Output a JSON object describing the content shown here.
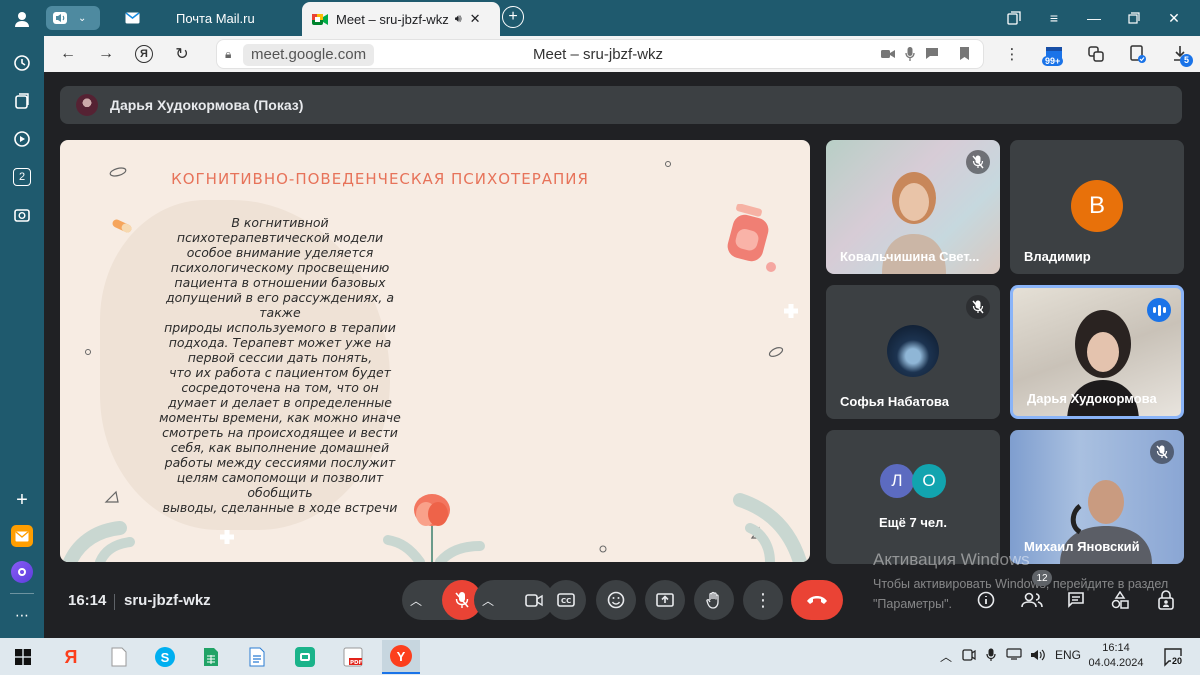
{
  "browser": {
    "tabs": [
      {
        "label": "Почта Mail.ru",
        "icon": "mail-icon"
      },
      {
        "label": "Meet – sru-jbzf-wkz",
        "icon": "google-meet-icon",
        "active": true
      }
    ],
    "address": {
      "domain": "meet.google.com",
      "title": "Meet – sru-jbzf-wkz"
    },
    "downloads_badge": "5",
    "extension_badge": "99+",
    "sidepanel_tab_count": "2"
  },
  "meet": {
    "presenter": "Дарья Худокормова (Показ)",
    "slide": {
      "title": "КОГНИТИВНО-ПОВЕДЕНЧЕСКАЯ ПСИХОТЕРАПИЯ",
      "body": "В когнитивной\nпсихотерапевтической модели\nособое внимание уделяется\nпсихологическому просвещению\nпациента в отношении базовых\nдопущений в его рассуждениях, а\nтакже\nприроды используемого в терапии\nподхода. Терапевт может уже на\nпервой сессии дать понять,\nчто их работа с пациентом будет\nсосредоточена на том, что он\nдумает и делает в определенные\nмоменты времени, как можно иначе\nсмотреть на происходящее и вести\nсебя, как выполнение домашней\nработы между сессиями послужит\nцелям самопомощи и позволит\nобобщить\nвыводы, сделанные в ходе встречи"
    },
    "participants": [
      {
        "name": "Ковальчишина Свет...",
        "muted": true
      },
      {
        "name": "Владимир",
        "avatar_letter": "В",
        "avatar_color": "#e8710a"
      },
      {
        "name": "Софья Набатова",
        "muted": true
      },
      {
        "name": "Дарья Худокормова",
        "speaking": true
      },
      {
        "name": "Ещё 7 чел.",
        "avatars": [
          {
            "letter": "Л",
            "color": "#5c6bc0"
          },
          {
            "letter": "О",
            "color": "#12a4af"
          }
        ]
      },
      {
        "name": "Михаил Яновский",
        "muted": true
      }
    ],
    "clock": "16:14",
    "meeting_code": "sru-jbzf-wkz",
    "people_count": "12"
  },
  "windows": {
    "activation_title": "Активация Windows",
    "activation_text": "Чтобы активировать Windows, перейдите в раздел \"Параметры\".",
    "lang": "ENG",
    "time": "16:14",
    "date": "04.04.2024",
    "notifications": "20"
  },
  "colors": {
    "meet_bg": "#202124",
    "tile_bg": "#3c4043",
    "end_call": "#ea4335",
    "accent_blue": "#1a73e8",
    "slide_title": "#e7735a"
  }
}
